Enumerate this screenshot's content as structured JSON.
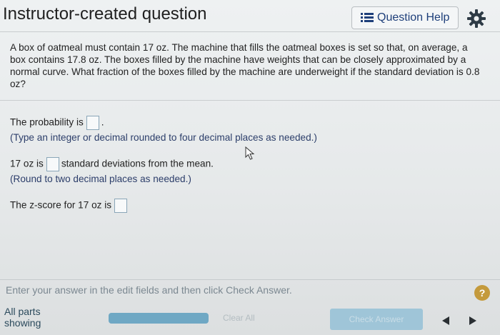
{
  "header": {
    "title": "Instructor-created question",
    "help_label": "Question Help"
  },
  "question": {
    "text": "A box of oatmeal must contain 17 oz. The machine that fills the oatmeal boxes is set so that, on average, a box contains 17.8 oz. The boxes filled by the machine have weights that can be closely approximated by a normal curve. What fraction of the boxes filled by the machine are underweight if the standard deviation is 0.8 oz?"
  },
  "parts": {
    "probability_prefix": "The probability is",
    "probability_suffix": ".",
    "probability_hint": "(Type an integer or decimal rounded to four decimal places as needed.)",
    "sd_prefix": "17 oz is",
    "sd_suffix": "standard deviations from the mean.",
    "sd_hint": "(Round to two decimal places as needed.)",
    "z_prefix": "The z-score for 17 oz is",
    "probability_value": "",
    "sd_value": "",
    "z_value": ""
  },
  "footer": {
    "instruction": "Enter your answer in the edit fields and then click Check Answer.",
    "help_mark": "?",
    "parts_line1": "All parts",
    "parts_line2": "showing",
    "clear_label": "Clear All",
    "check_label": "Check Answer"
  },
  "colors": {
    "accent": "#1e3f7a",
    "help_circle": "#c49a3c",
    "progress": "#6fa8c4",
    "check_button": "#9fc5d8"
  },
  "icons": {
    "help": "list-icon",
    "settings": "gear-icon",
    "prev": "triangle-left-icon",
    "next": "triangle-right-icon"
  }
}
